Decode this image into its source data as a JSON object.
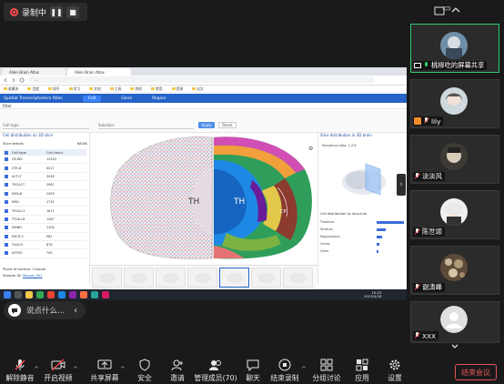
{
  "recording": {
    "label": "录制中",
    "pause_icon": "pause-icon",
    "stop_icon": "stop-icon"
  },
  "shared_screen": {
    "tabs": [
      "Allen Brain Atlas",
      "Allen Brain Atlas"
    ],
    "url": "...",
    "bookmarks": [
      "收藏夹",
      "百度",
      "知乎",
      "学习",
      "文档",
      "工具",
      "其他",
      "常用",
      "资源",
      "论文"
    ],
    "app": {
      "title": "Spatial Transcriptomics Atlas",
      "nav": [
        "Cell",
        "Gene",
        "Region"
      ]
    },
    "filter_label": "Filter",
    "selects": [
      "Cell type",
      "Subclass"
    ],
    "apply_label": "Apply",
    "reset_label": "Reset",
    "left": {
      "title": "Cell distribution on 3D slice",
      "sub_label": "Slice details",
      "sub_value": "88.8K",
      "columns": [
        "Cell type",
        "Cell count"
      ],
      "rows": [
        {
          "name": "CB-REL",
          "count": "12543"
        },
        {
          "name": "STR-D",
          "count": "4317"
        },
        {
          "name": "ACTI-T",
          "count": "3428"
        },
        {
          "name": "TEGLU-T",
          "count": "2961"
        },
        {
          "name": "MSN-B",
          "count": "2450"
        },
        {
          "name": "MSN",
          "count": "1732"
        },
        {
          "name": "TEGLU-3",
          "count": "1611"
        },
        {
          "name": "TTGLU-8",
          "count": "1287"
        },
        {
          "name": "DEINH",
          "count": "1104"
        },
        {
          "name": "EXCIT-2",
          "count": "982"
        },
        {
          "name": "OLIG-N",
          "count": "876"
        },
        {
          "name": "ASTRO",
          "count": "745"
        }
      ],
      "meta": [
        {
          "label": "Plane of section:",
          "value": "Coronal"
        },
        {
          "label": "Sample ID:",
          "value": "Mouse_001"
        }
      ]
    },
    "brain": {
      "left_label": "TH",
      "right_label": "TH",
      "region_label": "CP",
      "settings_icon": "gear-icon"
    },
    "right": {
      "title": "Slice distribution in 3D brain",
      "caption": "Sampling ratio: 1.2%",
      "legend_title": "Cell distribution by structure",
      "legend": [
        {
          "name": "Thalamus",
          "value": 0.95
        },
        {
          "name": "Striatum",
          "value": 0.3
        },
        {
          "name": "Hippocampus",
          "value": 0.18
        },
        {
          "name": "Cortex",
          "value": 0.1
        },
        {
          "name": "Other",
          "value": 0.06
        }
      ]
    },
    "taskbar": {
      "time": "10:23",
      "date": "2023/5/18"
    }
  },
  "chat": {
    "placeholder": "说点什么...",
    "icon": "chat-bubble-icon",
    "collapse_icon": "chevron-left-icon"
  },
  "sidebar": {
    "participants": [
      {
        "name": "桃柳吃的屏幕共享",
        "status": "sharing",
        "active": true
      },
      {
        "name": "lily",
        "status": "host-muted"
      },
      {
        "name": "淡淡风",
        "status": "muted"
      },
      {
        "name": "陈世颂",
        "status": "muted"
      },
      {
        "name": "谢涛峰",
        "status": "muted"
      },
      {
        "name": "XXX",
        "status": "muted"
      }
    ]
  },
  "toolbar": {
    "items": [
      {
        "label": "解除静音",
        "icon": "mic-muted-icon"
      },
      {
        "label": "开启视频",
        "icon": "camera-off-icon"
      },
      {
        "label": "共享屏幕",
        "icon": "share-screen-icon"
      },
      {
        "label": "安全",
        "icon": "shield-icon"
      },
      {
        "label": "邀请",
        "icon": "invite-icon"
      },
      {
        "label": "管理成员(70)",
        "icon": "participants-icon"
      },
      {
        "label": "聊天",
        "icon": "chat-icon"
      },
      {
        "label": "结束录制",
        "icon": "stop-record-icon"
      },
      {
        "label": "分组讨论",
        "icon": "breakout-icon"
      },
      {
        "label": "应用",
        "icon": "apps-icon"
      },
      {
        "label": "设置",
        "icon": "settings-icon"
      }
    ],
    "end_label": "结束会议"
  }
}
